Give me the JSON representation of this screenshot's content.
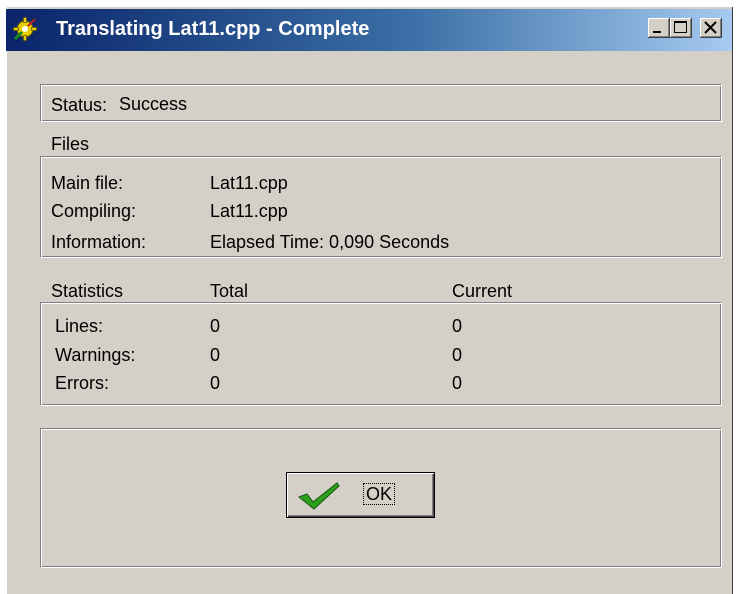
{
  "window": {
    "title": "Translating  Lat11.cpp - Complete",
    "controls": {
      "minimize_icon": "minimize-icon",
      "maximize_icon": "maximize-icon",
      "close_icon": "close-icon"
    }
  },
  "status": {
    "label": "Status:",
    "value": "Success"
  },
  "files": {
    "heading": "Files",
    "rows": [
      {
        "label": "Main file:",
        "value": "Lat11.cpp"
      },
      {
        "label": "Compiling:",
        "value": "Lat11.cpp"
      },
      {
        "label": "Information:",
        "value": "Elapsed Time: 0,090 Seconds"
      }
    ]
  },
  "statistics": {
    "heading": "Statistics",
    "total_header": "Total",
    "current_header": "Current",
    "rows": [
      {
        "label": "Lines:",
        "total": "0",
        "current": "0"
      },
      {
        "label": "Warnings:",
        "total": "0",
        "current": "0"
      },
      {
        "label": "Errors:",
        "total": "0",
        "current": "0"
      }
    ]
  },
  "ok_button": {
    "label": "OK",
    "icon": "checkmark-icon"
  },
  "colors": {
    "titlebar_start": "#0a246a",
    "titlebar_end": "#a6caf0",
    "face": "#d4d0c8",
    "check_green": "#2e9e1c"
  }
}
